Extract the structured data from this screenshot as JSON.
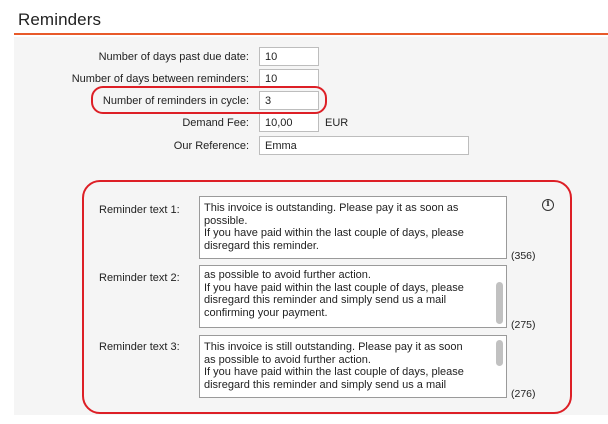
{
  "header": {
    "title": "Reminders"
  },
  "fields": [
    {
      "label": "Number of days past due date:",
      "value": "10"
    },
    {
      "label": "Number of days between reminders:",
      "value": "10"
    },
    {
      "label": "Number of reminders in cycle:",
      "value": "3"
    },
    {
      "label": "Demand Fee:",
      "value": "10,00",
      "unit": "EUR"
    },
    {
      "label": "Our Reference:",
      "value": "Emma"
    }
  ],
  "info_icon": {
    "glyph": "i",
    "icon": "info-icon"
  },
  "reminders": [
    {
      "label": "Reminder text 1:",
      "text": "This invoice is outstanding. Please pay it as soon as\npossible.\nIf you have paid within the last couple of days, please\ndisregard this reminder.",
      "count": "(356)"
    },
    {
      "label": "Reminder text 2:",
      "text": "as possible to avoid further action.\nIf you have paid within the last couple of days, please\ndisregard this reminder and simply send us a mail\nconfirming your payment.",
      "count": "(275)"
    },
    {
      "label": "Reminder text 3:",
      "text": "This invoice is still outstanding. Please pay it as soon\nas possible to avoid further action.\nIf you have paid within the last couple of days, please\ndisregard this reminder and simply send us a mail",
      "count": "(276)"
    }
  ],
  "colors": {
    "accent": "#e85a2a",
    "highlight": "#dd1f26",
    "panel": "#f5f5f5"
  }
}
